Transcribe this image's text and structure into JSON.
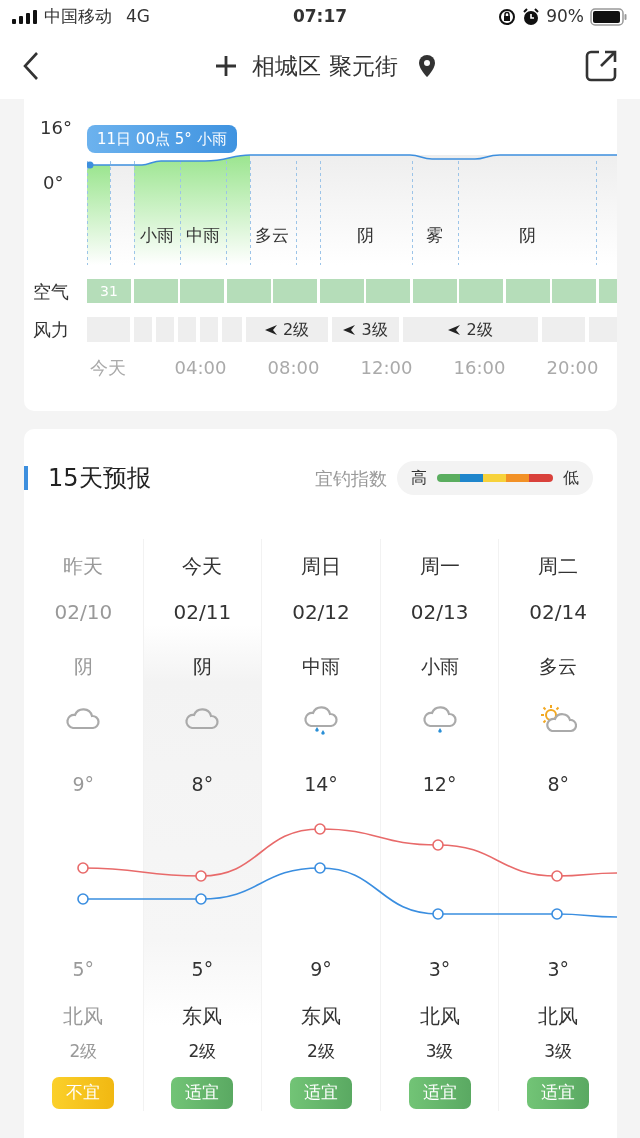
{
  "status_bar": {
    "carrier": "中国移动",
    "network": "4G",
    "time": "07:17",
    "battery": "90%"
  },
  "header": {
    "title": "相城区 聚元街"
  },
  "hourly": {
    "y_labels": [
      "16°",
      "0°"
    ],
    "tooltip": "11日 00点 5° 小雨",
    "conditions": [
      "小雨",
      "中雨",
      "多云",
      "阴",
      "雾",
      "阴"
    ],
    "air_label": "空气",
    "air_value": "31",
    "wind_label": "风力",
    "winds": [
      "2级",
      "3级",
      "2级"
    ],
    "times": [
      "今天",
      "04:00",
      "08:00",
      "12:00",
      "16:00",
      "20:00"
    ]
  },
  "forecast": {
    "title": "15天预报",
    "index_label": "宜钓指数",
    "scale_high": "高",
    "scale_low": "低",
    "days": [
      {
        "day": "昨天",
        "date": "02/10",
        "condition": "阴",
        "kind": "cloudy",
        "high": "9°",
        "low": "5°",
        "wind_dir": "北风",
        "wind_level": "2级",
        "fishing": "不宜",
        "suitable": false,
        "past": true,
        "selected": false
      },
      {
        "day": "今天",
        "date": "02/11",
        "condition": "阴",
        "kind": "cloudy",
        "high": "8°",
        "low": "5°",
        "wind_dir": "东风",
        "wind_level": "2级",
        "fishing": "适宜",
        "suitable": true,
        "past": false,
        "selected": true
      },
      {
        "day": "周日",
        "date": "02/12",
        "condition": "中雨",
        "kind": "moderate-rain",
        "high": "14°",
        "low": "9°",
        "wind_dir": "东风",
        "wind_level": "2级",
        "fishing": "适宜",
        "suitable": true,
        "past": false,
        "selected": false
      },
      {
        "day": "周一",
        "date": "02/13",
        "condition": "小雨",
        "kind": "light-rain",
        "high": "12°",
        "low": "3°",
        "wind_dir": "北风",
        "wind_level": "3级",
        "fishing": "适宜",
        "suitable": true,
        "past": false,
        "selected": false
      },
      {
        "day": "周二",
        "date": "02/14",
        "condition": "多云",
        "kind": "partly-cloudy",
        "high": "8°",
        "low": "3°",
        "wind_dir": "北风",
        "wind_level": "3级",
        "fishing": "适宜",
        "suitable": true,
        "past": false,
        "selected": false
      }
    ]
  }
}
